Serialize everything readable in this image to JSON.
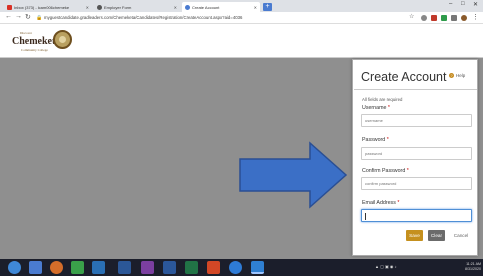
{
  "browser": {
    "tabs": [
      {
        "label": "Inbox (373) - lcam006chemeke",
        "favicon_color": "#d93025",
        "active": false
      },
      {
        "label": "Employer Form",
        "favicon_color": "#555555",
        "active": false
      },
      {
        "label": "Create Account",
        "favicon_color": "#4a7bd0",
        "active": true
      }
    ],
    "url": "myguestcandidate.gradleaders.com/Chemeketa/Candidates/Registration/CreateAccount.aspx?aid=4036"
  },
  "college": {
    "logo_top": "Discover",
    "logo_name": "Chemeketa",
    "logo_sub": "Community College"
  },
  "modal": {
    "title": "Create Account",
    "help_label": "Help",
    "required_note": "All fields are required",
    "fields": [
      {
        "label": "Username",
        "placeholder": "username",
        "value": ""
      },
      {
        "label": "Password",
        "placeholder": "password",
        "value": ""
      },
      {
        "label": "Confirm Password",
        "placeholder": "confirm password",
        "value": ""
      },
      {
        "label": "Email Address",
        "placeholder": "",
        "value": ""
      }
    ],
    "buttons": {
      "save": "Save",
      "clear": "Clear",
      "cancel": "Cancel"
    }
  },
  "taskbar": {
    "time": "11:21 AM",
    "date": "8/31/2020"
  },
  "colors": {
    "accent_gold": "#c5901e",
    "arrow_blue": "#3b6fc6",
    "overlay_gray": "#8f8f8f"
  }
}
